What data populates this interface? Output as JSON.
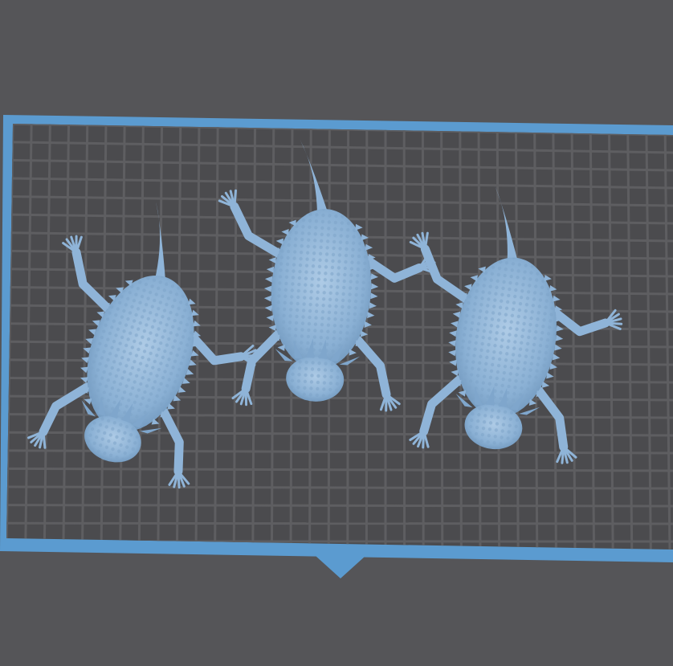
{
  "viewport": {
    "background_color": "#555558",
    "plate_grid_color": "#5e5e61",
    "plate_fill_color": "#4b4b4e",
    "plate_frame_color": "#5b9bd0",
    "model_color": "#8fb4d8",
    "front_indicator": "triangle-marker"
  },
  "models": [
    {
      "name": "horned-lizard-left"
    },
    {
      "name": "horned-lizard-middle"
    },
    {
      "name": "horned-lizard-right"
    }
  ]
}
